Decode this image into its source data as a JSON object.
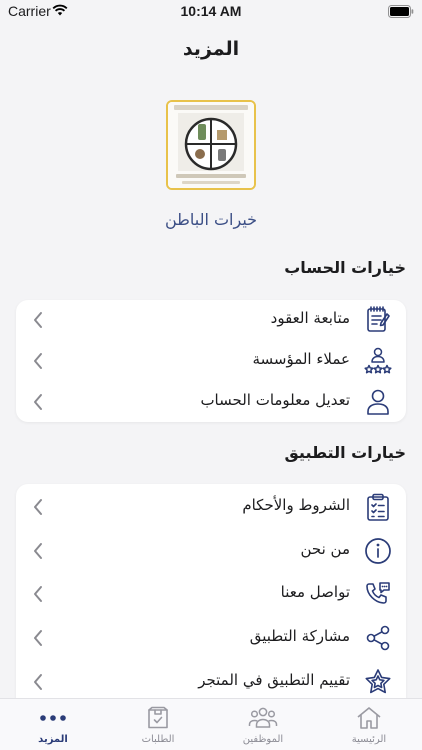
{
  "status_bar": {
    "carrier": "Carrier",
    "time": "10:14 AM"
  },
  "header": {
    "title": "المزيد"
  },
  "profile": {
    "name": "خيرات الباطن"
  },
  "account_section": {
    "title": "خيارات الحساب",
    "items": [
      {
        "label": "متابعة العقود",
        "icon": "contract-icon"
      },
      {
        "label": "عملاء المؤسسة",
        "icon": "clients-icon"
      },
      {
        "label": "تعديل معلومات الحساب",
        "icon": "user-icon"
      }
    ]
  },
  "app_section": {
    "title": "خيارات التطبيق",
    "items": [
      {
        "label": "الشروط والأحكام",
        "icon": "clipboard-checklist-icon"
      },
      {
        "label": "من نحن",
        "icon": "info-icon"
      },
      {
        "label": "تواصل معنا",
        "icon": "phone-chat-icon"
      },
      {
        "label": "مشاركة التطبيق",
        "icon": "share-icon"
      },
      {
        "label": "تقييم التطبيق في المتجر",
        "icon": "star-icon"
      }
    ]
  },
  "tab_bar": {
    "tabs": [
      {
        "label": "الرئيسية",
        "icon": "home-icon"
      },
      {
        "label": "الموظفين",
        "icon": "employees-icon"
      },
      {
        "label": "الطلبات",
        "icon": "orders-box-icon"
      },
      {
        "label": "المزيد",
        "icon": "more-dots-icon",
        "active": true
      }
    ]
  },
  "colors": {
    "accent": "#2b3c78",
    "logo_border": "#e8c24a",
    "icon_color": "#2b3c78"
  }
}
